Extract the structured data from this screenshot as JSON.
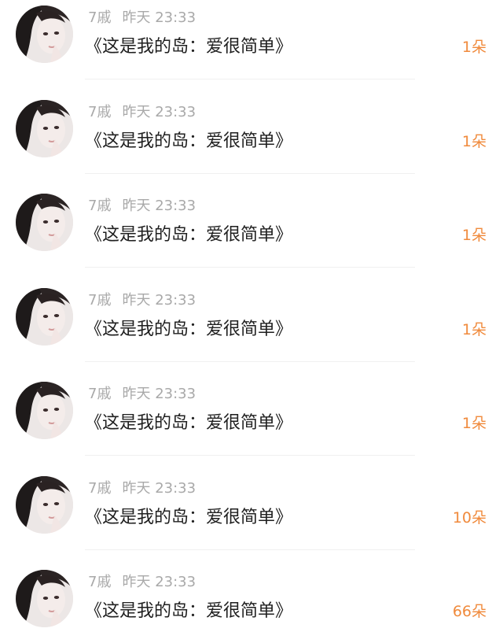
{
  "feed": {
    "items": [
      {
        "username": "7戚",
        "date": "昨天",
        "time": "23:33",
        "content": "《这是我的岛：爱很简单》",
        "gift": "1朵"
      },
      {
        "username": "7戚",
        "date": "昨天",
        "time": "23:33",
        "content": "《这是我的岛：爱很简单》",
        "gift": "1朵"
      },
      {
        "username": "7戚",
        "date": "昨天",
        "time": "23:33",
        "content": "《这是我的岛：爱很简单》",
        "gift": "1朵"
      },
      {
        "username": "7戚",
        "date": "昨天",
        "time": "23:33",
        "content": "《这是我的岛：爱很简单》",
        "gift": "1朵"
      },
      {
        "username": "7戚",
        "date": "昨天",
        "time": "23:33",
        "content": "《这是我的岛：爱很简单》",
        "gift": "1朵"
      },
      {
        "username": "7戚",
        "date": "昨天",
        "time": "23:33",
        "content": "《这是我的岛：爱很简单》",
        "gift": "10朵"
      },
      {
        "username": "7戚",
        "date": "昨天",
        "time": "23:33",
        "content": "《这是我的岛：爱很简单》",
        "gift": "66朵"
      }
    ]
  },
  "colors": {
    "gift": "#f08a3c",
    "meta": "#a9a9a9",
    "text": "#1f1f1f",
    "divider": "#f0f0f0"
  },
  "icons": {
    "avatar": "user-avatar-photo"
  }
}
